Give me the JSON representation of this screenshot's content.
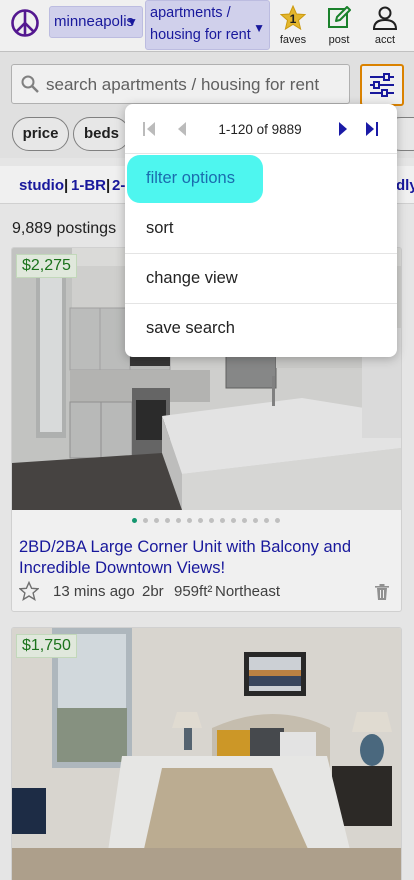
{
  "header": {
    "city": "minneapolis",
    "category_line1": "apartments /",
    "category_line2": "housing for rent",
    "faves_count": "1",
    "faves_label": "faves",
    "post_label": "post",
    "acct_label": "acct"
  },
  "search": {
    "placeholder": "search apartments / housing for rent"
  },
  "chips": [
    "price",
    "beds"
  ],
  "quick_filters": {
    "studio": "studio",
    "sep": "|",
    "one_br": "1-BR",
    "two_partial": "2-",
    "end_partial": "dly"
  },
  "results": {
    "count_text": "9,889 postings"
  },
  "listings": [
    {
      "price": "$2,275",
      "title": "2BD/2BA Large Corner Unit with Balcony and Incredible Downtown Views!",
      "age": "13 mins ago",
      "beds": "2br",
      "sqft": "959ft²",
      "neighborhood": "Northeast",
      "image_count": 13,
      "active_image": 0
    },
    {
      "price": "$1,750"
    }
  ],
  "popup": {
    "range": "1-120 of 9889",
    "items": [
      "filter options",
      "sort",
      "change view",
      "save search"
    ]
  },
  "colors": {
    "link_blue": "#1a1aa6",
    "accent_orange": "#e88b00",
    "highlight_cyan": "#4ef6ef",
    "price_green": "#1d7a1d"
  },
  "icons": {
    "logo": "peace-sign-icon",
    "faves": "star-icon",
    "post": "edit-icon",
    "acct": "person-icon",
    "search": "search-icon",
    "filter": "sliders-icon",
    "trash": "trash-icon"
  }
}
